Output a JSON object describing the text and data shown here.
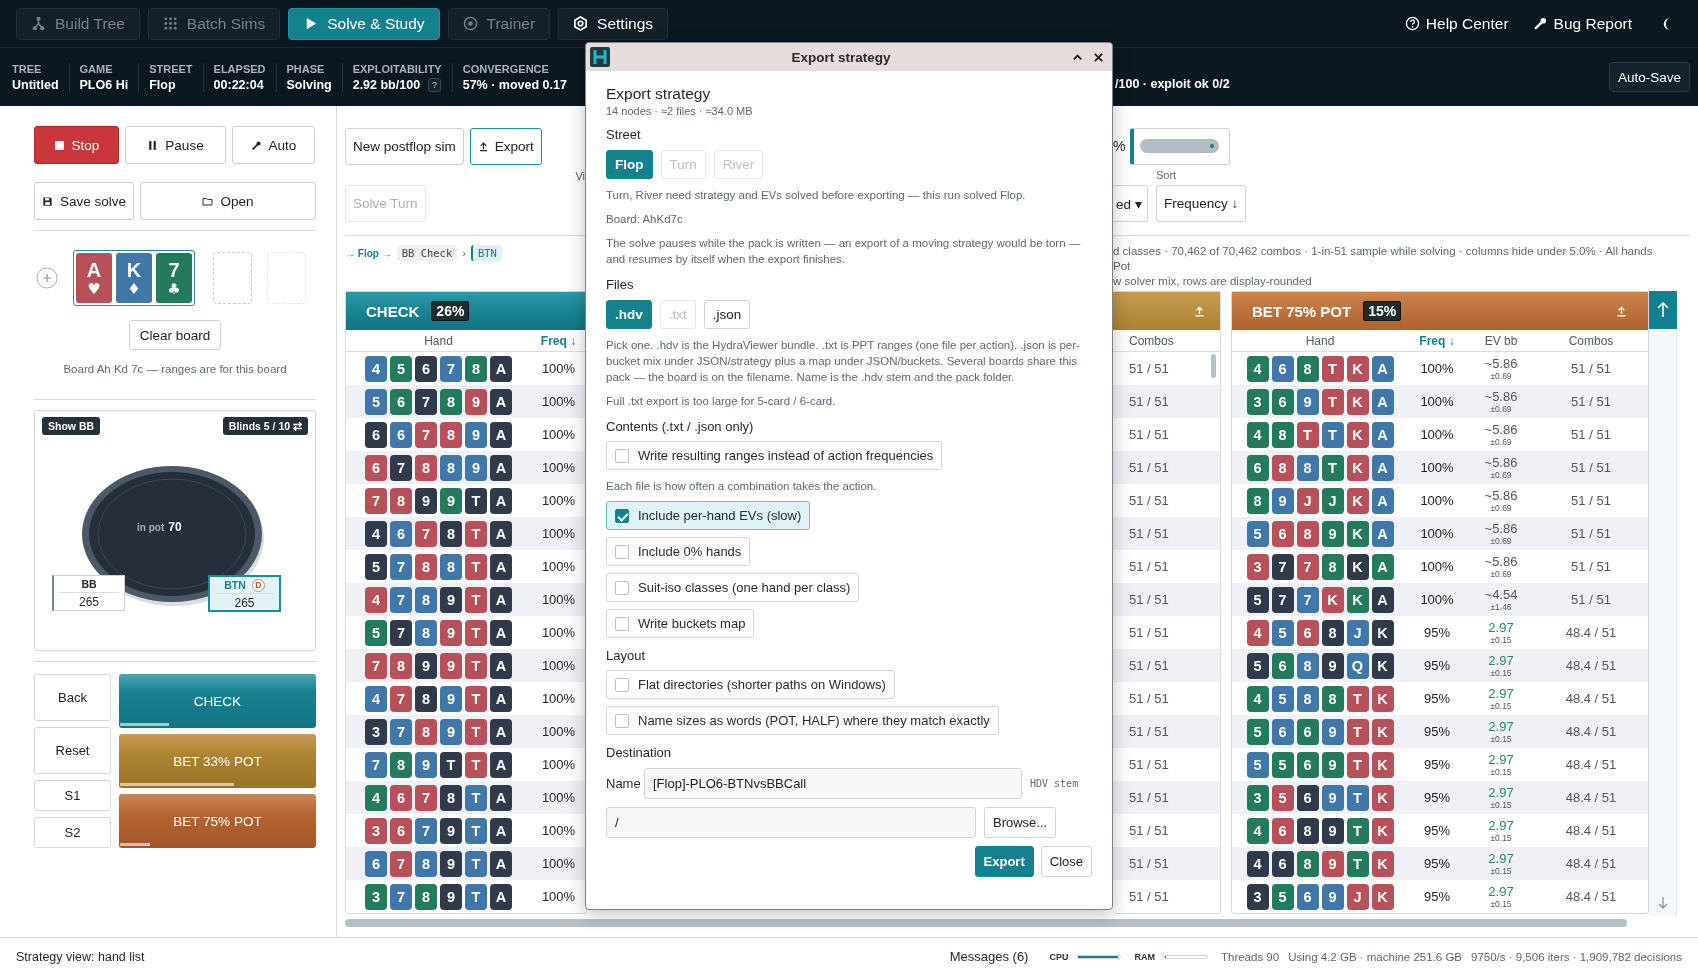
{
  "nav": {
    "tabs": [
      {
        "label": "Build Tree",
        "selected": false,
        "disabled": true
      },
      {
        "label": "Batch Sims",
        "selected": false,
        "disabled": true
      },
      {
        "label": "Solve & Study",
        "selected": true,
        "disabled": false
      },
      {
        "label": "Trainer",
        "selected": false,
        "disabled": true
      },
      {
        "label": "Settings",
        "selected": false,
        "disabled": false
      }
    ],
    "links": [
      "Help Center",
      "Bug Report"
    ]
  },
  "stats": {
    "items": [
      {
        "label": "TREE",
        "value": "Untitled"
      },
      {
        "label": "GAME",
        "value": "PLO6 Hi"
      },
      {
        "label": "STREET",
        "value": "Flop"
      },
      {
        "label": "ELAPSED",
        "value": "00:22:04"
      },
      {
        "label": "PHASE",
        "value": "Solving"
      },
      {
        "label": "EXPLOITABILITY",
        "value": "2.92 bb/100",
        "help": "?"
      },
      {
        "label": "CONVERGENCE",
        "value": "57% · moved 0.17"
      }
    ],
    "tail": "/100 · exploit ok 0/2",
    "auto_save": "Auto-Save"
  },
  "sidebar": {
    "run_buttons": [
      {
        "label": "Stop",
        "kind": "stop"
      },
      {
        "label": "Pause",
        "kind": "pause"
      },
      {
        "label": "Auto",
        "kind": "auto"
      }
    ],
    "file_buttons": [
      {
        "label": "Save solve",
        "kind": "save"
      },
      {
        "label": "Open",
        "kind": "open"
      }
    ],
    "board": {
      "cards": [
        {
          "rank": "A",
          "suit": "♥",
          "color": "#b8505a"
        },
        {
          "rank": "K",
          "suit": "♦",
          "color": "#3f78a8"
        },
        {
          "rank": "7",
          "suit": "♣",
          "color": "#237a5c"
        }
      ],
      "clear": "Clear board",
      "caption": "Board Ah Kd 7c — ranges are for this board"
    },
    "table": {
      "show_bb": "Show BB",
      "blinds": "Blinds 5 / 10 ⇄",
      "pot_label": "in pot",
      "pot": "70",
      "seats": [
        {
          "name": "BB",
          "stack": "265",
          "active": false
        },
        {
          "name": "BTN",
          "stack": "265",
          "active": true,
          "dealer": "D"
        }
      ]
    },
    "nav_buttons": [
      "Back",
      "Reset",
      "S1",
      "S2"
    ],
    "actions": [
      {
        "label": "CHECK",
        "kind": "check",
        "level": 0.25
      },
      {
        "label": "BET 33% POT",
        "kind": "bet_small",
        "level": 0.58
      },
      {
        "label": "BET 75% POT",
        "kind": "bet_large",
        "level": 0.15
      }
    ]
  },
  "toolbar": {
    "buttons": [
      {
        "label": "New postflop sim",
        "kind": "plain",
        "focused": false
      },
      {
        "label": "Export",
        "kind": "export",
        "focused": true
      }
    ],
    "solve_turn": {
      "label": "Solve Turn",
      "disabled": true
    },
    "view_label": "Vi",
    "percent": "%",
    "slider": {
      "level": 0.95
    },
    "filter": "ed ▾",
    "sort_label": "Sort",
    "sort": "Frequency ↓"
  },
  "breadcrumb": {
    "lead": "→ Flop →",
    "sep": "›",
    "steps": [
      {
        "label": "BB Check",
        "selected": false
      },
      {
        "label": "BTN",
        "selected": true
      }
    ]
  },
  "info_lines": [
    "d classes · 70,462 of 70,462 combos · 1-in-51 sample while solving · columns hide under 5.0% · All hands",
    "Pot",
    "w solver mix, rows are display-rounded"
  ],
  "panels": {
    "check": {
      "title": "CHECK",
      "share": "26%",
      "columns": [
        {
          "label": "Hand",
          "sorted": false
        },
        {
          "label": "Freq ↓",
          "sorted": true
        }
      ],
      "rows": [
        {
          "cards": [
            {
              "rank": "4",
              "color": "#3f78a8"
            },
            {
              "rank": "5",
              "color": "#237a5c"
            },
            {
              "rank": "6",
              "color": "#303a4b"
            },
            {
              "rank": "7",
              "color": "#3f78a8"
            },
            {
              "rank": "8",
              "color": "#237a5c"
            },
            {
              "rank": "A",
              "color": "#303a4b"
            }
          ],
          "freq": "100%"
        },
        {
          "cards": [
            {
              "rank": "5",
              "color": "#3f78a8"
            },
            {
              "rank": "6",
              "color": "#237a5c"
            },
            {
              "rank": "7",
              "color": "#303a4b"
            },
            {
              "rank": "8",
              "color": "#237a5c"
            },
            {
              "rank": "9",
              "color": "#b8505a"
            },
            {
              "rank": "A",
              "color": "#303a4b"
            }
          ],
          "freq": "100%"
        },
        {
          "cards": [
            {
              "rank": "6",
              "color": "#303a4b"
            },
            {
              "rank": "6",
              "color": "#3f78a8"
            },
            {
              "rank": "7",
              "color": "#b8505a"
            },
            {
              "rank": "8",
              "color": "#b8505a"
            },
            {
              "rank": "9",
              "color": "#3f78a8"
            },
            {
              "rank": "A",
              "color": "#303a4b"
            }
          ],
          "freq": "100%"
        },
        {
          "cards": [
            {
              "rank": "6",
              "color": "#b8505a"
            },
            {
              "rank": "7",
              "color": "#303a4b"
            },
            {
              "rank": "8",
              "color": "#b8505a"
            },
            {
              "rank": "8",
              "color": "#3f78a8"
            },
            {
              "rank": "9",
              "color": "#3f78a8"
            },
            {
              "rank": "A",
              "color": "#303a4b"
            }
          ],
          "freq": "100%"
        },
        {
          "cards": [
            {
              "rank": "7",
              "color": "#b8505a"
            },
            {
              "rank": "8",
              "color": "#b8505a"
            },
            {
              "rank": "9",
              "color": "#303a4b"
            },
            {
              "rank": "9",
              "color": "#237a5c"
            },
            {
              "rank": "T",
              "color": "#303a4b"
            },
            {
              "rank": "A",
              "color": "#303a4b"
            }
          ],
          "freq": "100%"
        },
        {
          "cards": [
            {
              "rank": "4",
              "color": "#303a4b"
            },
            {
              "rank": "6",
              "color": "#3f78a8"
            },
            {
              "rank": "7",
              "color": "#b8505a"
            },
            {
              "rank": "8",
              "color": "#303a4b"
            },
            {
              "rank": "T",
              "color": "#b8505a"
            },
            {
              "rank": "A",
              "color": "#303a4b"
            }
          ],
          "freq": "100%"
        },
        {
          "cards": [
            {
              "rank": "5",
              "color": "#303a4b"
            },
            {
              "rank": "7",
              "color": "#3f78a8"
            },
            {
              "rank": "8",
              "color": "#b8505a"
            },
            {
              "rank": "8",
              "color": "#3f78a8"
            },
            {
              "rank": "T",
              "color": "#b8505a"
            },
            {
              "rank": "A",
              "color": "#303a4b"
            }
          ],
          "freq": "100%"
        },
        {
          "cards": [
            {
              "rank": "4",
              "color": "#b8505a"
            },
            {
              "rank": "7",
              "color": "#3f78a8"
            },
            {
              "rank": "8",
              "color": "#3f78a8"
            },
            {
              "rank": "9",
              "color": "#303a4b"
            },
            {
              "rank": "T",
              "color": "#b8505a"
            },
            {
              "rank": "A",
              "color": "#303a4b"
            }
          ],
          "freq": "100%"
        },
        {
          "cards": [
            {
              "rank": "5",
              "color": "#237a5c"
            },
            {
              "rank": "7",
              "color": "#303a4b"
            },
            {
              "rank": "8",
              "color": "#3f78a8"
            },
            {
              "rank": "9",
              "color": "#b8505a"
            },
            {
              "rank": "T",
              "color": "#b8505a"
            },
            {
              "rank": "A",
              "color": "#303a4b"
            }
          ],
          "freq": "100%"
        },
        {
          "cards": [
            {
              "rank": "7",
              "color": "#b8505a"
            },
            {
              "rank": "8",
              "color": "#b8505a"
            },
            {
              "rank": "9",
              "color": "#303a4b"
            },
            {
              "rank": "9",
              "color": "#b8505a"
            },
            {
              "rank": "T",
              "color": "#b8505a"
            },
            {
              "rank": "A",
              "color": "#303a4b"
            }
          ],
          "freq": "100%"
        },
        {
          "cards": [
            {
              "rank": "4",
              "color": "#3f78a8"
            },
            {
              "rank": "7",
              "color": "#b8505a"
            },
            {
              "rank": "8",
              "color": "#303a4b"
            },
            {
              "rank": "9",
              "color": "#3f78a8"
            },
            {
              "rank": "T",
              "color": "#b8505a"
            },
            {
              "rank": "A",
              "color": "#303a4b"
            }
          ],
          "freq": "100%"
        },
        {
          "cards": [
            {
              "rank": "3",
              "color": "#303a4b"
            },
            {
              "rank": "7",
              "color": "#3f78a8"
            },
            {
              "rank": "8",
              "color": "#b8505a"
            },
            {
              "rank": "9",
              "color": "#3f78a8"
            },
            {
              "rank": "T",
              "color": "#b8505a"
            },
            {
              "rank": "A",
              "color": "#303a4b"
            }
          ],
          "freq": "100%"
        },
        {
          "cards": [
            {
              "rank": "7",
              "color": "#3f78a8"
            },
            {
              "rank": "8",
              "color": "#237a5c"
            },
            {
              "rank": "9",
              "color": "#3f78a8"
            },
            {
              "rank": "T",
              "color": "#303a4b"
            },
            {
              "rank": "T",
              "color": "#b8505a"
            },
            {
              "rank": "A",
              "color": "#303a4b"
            }
          ],
          "freq": "100%"
        },
        {
          "cards": [
            {
              "rank": "4",
              "color": "#237a5c"
            },
            {
              "rank": "6",
              "color": "#b8505a"
            },
            {
              "rank": "7",
              "color": "#b8505a"
            },
            {
              "rank": "8",
              "color": "#303a4b"
            },
            {
              "rank": "T",
              "color": "#3f78a8"
            },
            {
              "rank": "A",
              "color": "#303a4b"
            }
          ],
          "freq": "100%"
        },
        {
          "cards": [
            {
              "rank": "3",
              "color": "#b8505a"
            },
            {
              "rank": "6",
              "color": "#b8505a"
            },
            {
              "rank": "7",
              "color": "#3f78a8"
            },
            {
              "rank": "9",
              "color": "#303a4b"
            },
            {
              "rank": "T",
              "color": "#3f78a8"
            },
            {
              "rank": "A",
              "color": "#303a4b"
            }
          ],
          "freq": "100%"
        },
        {
          "cards": [
            {
              "rank": "6",
              "color": "#3f78a8"
            },
            {
              "rank": "7",
              "color": "#b8505a"
            },
            {
              "rank": "8",
              "color": "#3f78a8"
            },
            {
              "rank": "9",
              "color": "#303a4b"
            },
            {
              "rank": "T",
              "color": "#3f78a8"
            },
            {
              "rank": "A",
              "color": "#303a4b"
            }
          ],
          "freq": "100%"
        },
        {
          "cards": [
            {
              "rank": "3",
              "color": "#237a5c"
            },
            {
              "rank": "7",
              "color": "#3f78a8"
            },
            {
              "rank": "8",
              "color": "#237a5c"
            },
            {
              "rank": "9",
              "color": "#303a4b"
            },
            {
              "rank": "T",
              "color": "#3f78a8"
            },
            {
              "rank": "A",
              "color": "#303a4b"
            }
          ],
          "freq": "100%"
        }
      ]
    },
    "bet33": {
      "columns": [
        "Combos"
      ],
      "rows": [
        "51 / 51",
        "51 / 51",
        "51 / 51",
        "51 / 51",
        "51 / 51",
        "51 / 51",
        "51 / 51",
        "51 / 51",
        "51 / 51",
        "51 / 51",
        "51 / 51",
        "51 / 51",
        "51 / 51",
        "51 / 51",
        "51 / 51",
        "51 / 51",
        "51 / 51"
      ]
    },
    "bet75": {
      "title": "BET 75% POT",
      "share": "15%",
      "columns": [
        {
          "label": "Hand",
          "sorted": false
        },
        {
          "label": "Freq ↓",
          "sorted": true
        },
        {
          "label": "EV bb",
          "sorted": false
        },
        {
          "label": "Combos",
          "sorted": false
        }
      ],
      "rows": [
        {
          "cards": [
            {
              "rank": "4",
              "color": "#237a5c"
            },
            {
              "rank": "6",
              "color": "#3f78a8"
            },
            {
              "rank": "8",
              "color": "#237a5c"
            },
            {
              "rank": "T",
              "color": "#b8505a"
            },
            {
              "rank": "K",
              "color": "#b8505a"
            },
            {
              "rank": "A",
              "color": "#3f78a8"
            }
          ],
          "freq": "100%",
          "ev": "~5.86",
          "ev_err": "±0.69",
          "ev_estimated": true,
          "combos": "51 / 51"
        },
        {
          "cards": [
            {
              "rank": "3",
              "color": "#237a5c"
            },
            {
              "rank": "6",
              "color": "#237a5c"
            },
            {
              "rank": "9",
              "color": "#3f78a8"
            },
            {
              "rank": "T",
              "color": "#b8505a"
            },
            {
              "rank": "K",
              "color": "#b8505a"
            },
            {
              "rank": "A",
              "color": "#3f78a8"
            }
          ],
          "freq": "100%",
          "ev": "~5.86",
          "ev_err": "±0.69",
          "ev_estimated": true,
          "combos": "51 / 51"
        },
        {
          "cards": [
            {
              "rank": "4",
              "color": "#237a5c"
            },
            {
              "rank": "8",
              "color": "#237a5c"
            },
            {
              "rank": "T",
              "color": "#b8505a"
            },
            {
              "rank": "T",
              "color": "#3f78a8"
            },
            {
              "rank": "K",
              "color": "#b8505a"
            },
            {
              "rank": "A",
              "color": "#3f78a8"
            }
          ],
          "freq": "100%",
          "ev": "~5.86",
          "ev_err": "±0.69",
          "ev_estimated": true,
          "combos": "51 / 51"
        },
        {
          "cards": [
            {
              "rank": "6",
              "color": "#237a5c"
            },
            {
              "rank": "8",
              "color": "#b8505a"
            },
            {
              "rank": "8",
              "color": "#3f78a8"
            },
            {
              "rank": "T",
              "color": "#237a5c"
            },
            {
              "rank": "K",
              "color": "#b8505a"
            },
            {
              "rank": "A",
              "color": "#3f78a8"
            }
          ],
          "freq": "100%",
          "ev": "~5.86",
          "ev_err": "±0.69",
          "ev_estimated": true,
          "combos": "51 / 51"
        },
        {
          "cards": [
            {
              "rank": "8",
              "color": "#237a5c"
            },
            {
              "rank": "9",
              "color": "#3f78a8"
            },
            {
              "rank": "J",
              "color": "#b8505a"
            },
            {
              "rank": "J",
              "color": "#237a5c"
            },
            {
              "rank": "K",
              "color": "#b8505a"
            },
            {
              "rank": "A",
              "color": "#3f78a8"
            }
          ],
          "freq": "100%",
          "ev": "~5.86",
          "ev_err": "±0.69",
          "ev_estimated": true,
          "combos": "51 / 51"
        },
        {
          "cards": [
            {
              "rank": "5",
              "color": "#3f78a8"
            },
            {
              "rank": "6",
              "color": "#b8505a"
            },
            {
              "rank": "8",
              "color": "#b8505a"
            },
            {
              "rank": "9",
              "color": "#237a5c"
            },
            {
              "rank": "K",
              "color": "#237a5c"
            },
            {
              "rank": "A",
              "color": "#3f78a8"
            }
          ],
          "freq": "100%",
          "ev": "~5.86",
          "ev_err": "±0.69",
          "ev_estimated": true,
          "combos": "51 / 51"
        },
        {
          "cards": [
            {
              "rank": "3",
              "color": "#b8505a"
            },
            {
              "rank": "7",
              "color": "#303a4b"
            },
            {
              "rank": "7",
              "color": "#b8505a"
            },
            {
              "rank": "8",
              "color": "#237a5c"
            },
            {
              "rank": "K",
              "color": "#303a4b"
            },
            {
              "rank": "A",
              "color": "#237a5c"
            }
          ],
          "freq": "100%",
          "ev": "~5.86",
          "ev_err": "±0.69",
          "ev_estimated": true,
          "combos": "51 / 51"
        },
        {
          "cards": [
            {
              "rank": "5",
              "color": "#303a4b"
            },
            {
              "rank": "7",
              "color": "#303a4b"
            },
            {
              "rank": "7",
              "color": "#3f78a8"
            },
            {
              "rank": "K",
              "color": "#b8505a"
            },
            {
              "rank": "K",
              "color": "#237a5c"
            },
            {
              "rank": "A",
              "color": "#303a4b"
            }
          ],
          "freq": "100%",
          "ev": "~4.54",
          "ev_err": "±1.46",
          "ev_estimated": true,
          "combos": "51 / 51"
        },
        {
          "cards": [
            {
              "rank": "4",
              "color": "#b8505a"
            },
            {
              "rank": "5",
              "color": "#3f78a8"
            },
            {
              "rank": "6",
              "color": "#b8505a"
            },
            {
              "rank": "8",
              "color": "#303a4b"
            },
            {
              "rank": "J",
              "color": "#3f78a8"
            },
            {
              "rank": "K",
              "color": "#303a4b"
            }
          ],
          "freq": "95%",
          "ev": "2.97",
          "ev_err": "±0.15",
          "ev_estimated": false,
          "combos": "48.4 / 51"
        },
        {
          "cards": [
            {
              "rank": "5",
              "color": "#303a4b"
            },
            {
              "rank": "6",
              "color": "#237a5c"
            },
            {
              "rank": "8",
              "color": "#3f78a8"
            },
            {
              "rank": "9",
              "color": "#303a4b"
            },
            {
              "rank": "Q",
              "color": "#3f78a8"
            },
            {
              "rank": "K",
              "color": "#303a4b"
            }
          ],
          "freq": "95%",
          "ev": "2.97",
          "ev_err": "±0.15",
          "ev_estimated": false,
          "combos": "48.4 / 51"
        },
        {
          "cards": [
            {
              "rank": "4",
              "color": "#237a5c"
            },
            {
              "rank": "5",
              "color": "#3f78a8"
            },
            {
              "rank": "8",
              "color": "#3f78a8"
            },
            {
              "rank": "8",
              "color": "#237a5c"
            },
            {
              "rank": "T",
              "color": "#b8505a"
            },
            {
              "rank": "K",
              "color": "#b8505a"
            }
          ],
          "freq": "95%",
          "ev": "2.97",
          "ev_err": "±0.15",
          "ev_estimated": false,
          "combos": "48.4 / 51"
        },
        {
          "cards": [
            {
              "rank": "5",
              "color": "#237a5c"
            },
            {
              "rank": "6",
              "color": "#3f78a8"
            },
            {
              "rank": "6",
              "color": "#237a5c"
            },
            {
              "rank": "9",
              "color": "#3f78a8"
            },
            {
              "rank": "T",
              "color": "#b8505a"
            },
            {
              "rank": "K",
              "color": "#b8505a"
            }
          ],
          "freq": "95%",
          "ev": "2.97",
          "ev_err": "±0.15",
          "ev_estimated": false,
          "combos": "48.4 / 51"
        },
        {
          "cards": [
            {
              "rank": "5",
              "color": "#3f78a8"
            },
            {
              "rank": "5",
              "color": "#237a5c"
            },
            {
              "rank": "6",
              "color": "#237a5c"
            },
            {
              "rank": "9",
              "color": "#237a5c"
            },
            {
              "rank": "T",
              "color": "#b8505a"
            },
            {
              "rank": "K",
              "color": "#b8505a"
            }
          ],
          "freq": "95%",
          "ev": "2.97",
          "ev_err": "±0.15",
          "ev_estimated": false,
          "combos": "48.4 / 51"
        },
        {
          "cards": [
            {
              "rank": "3",
              "color": "#237a5c"
            },
            {
              "rank": "5",
              "color": "#b8505a"
            },
            {
              "rank": "6",
              "color": "#303a4b"
            },
            {
              "rank": "9",
              "color": "#3f78a8"
            },
            {
              "rank": "T",
              "color": "#3f78a8"
            },
            {
              "rank": "K",
              "color": "#b8505a"
            }
          ],
          "freq": "95%",
          "ev": "2.97",
          "ev_err": "±0.15",
          "ev_estimated": false,
          "combos": "48.4 / 51"
        },
        {
          "cards": [
            {
              "rank": "4",
              "color": "#237a5c"
            },
            {
              "rank": "6",
              "color": "#b8505a"
            },
            {
              "rank": "8",
              "color": "#303a4b"
            },
            {
              "rank": "9",
              "color": "#303a4b"
            },
            {
              "rank": "T",
              "color": "#237a5c"
            },
            {
              "rank": "K",
              "color": "#b8505a"
            }
          ],
          "freq": "95%",
          "ev": "2.97",
          "ev_err": "±0.15",
          "ev_estimated": false,
          "combos": "48.4 / 51"
        },
        {
          "cards": [
            {
              "rank": "4",
              "color": "#303a4b"
            },
            {
              "rank": "6",
              "color": "#303a4b"
            },
            {
              "rank": "8",
              "color": "#237a5c"
            },
            {
              "rank": "9",
              "color": "#b8505a"
            },
            {
              "rank": "T",
              "color": "#237a5c"
            },
            {
              "rank": "K",
              "color": "#b8505a"
            }
          ],
          "freq": "95%",
          "ev": "2.97",
          "ev_err": "±0.15",
          "ev_estimated": false,
          "combos": "48.4 / 51"
        },
        {
          "cards": [
            {
              "rank": "3",
              "color": "#303a4b"
            },
            {
              "rank": "5",
              "color": "#237a5c"
            },
            {
              "rank": "6",
              "color": "#3f78a8"
            },
            {
              "rank": "9",
              "color": "#3f78a8"
            },
            {
              "rank": "J",
              "color": "#b8505a"
            },
            {
              "rank": "K",
              "color": "#b8505a"
            }
          ],
          "freq": "95%",
          "ev": "2.97",
          "ev_err": "±0.15",
          "ev_estimated": false,
          "combos": "48.4 / 51"
        }
      ]
    }
  },
  "dialog": {
    "title": "Export strategy",
    "heading": "Export strategy",
    "summary": "14 nodes · ≈2 files · ≈34.0 MB",
    "street": {
      "label": "Street",
      "options": [
        {
          "label": "Flop",
          "selected": true,
          "disabled": false
        },
        {
          "label": "Turn",
          "selected": false,
          "disabled": true
        },
        {
          "label": "River",
          "selected": false,
          "disabled": true
        }
      ]
    },
    "street_note": "Turn, River need strategy and EVs solved before exporting — this run solved Flop.",
    "board": "Board: AhKd7c",
    "pause_note": "The solve pauses while the pack is written — an export of a moving strategy would be torn — and resumes by itself when the export finishes.",
    "files": {
      "label": "Files",
      "options": [
        {
          "label": ".hdv",
          "selected": true,
          "disabled": false
        },
        {
          "label": ".txt",
          "selected": false,
          "disabled": true
        },
        {
          "label": ".json",
          "selected": false,
          "disabled": false
        }
      ]
    },
    "files_note": "Pick one. .hdv is the HydraViewer bundle. .txt is PPT ranges (one file per action). .json is per-bucket mix under JSON/strategy plus a map under JSON/buckets. Several boards share this pack — the board is on the filename. Name is the .hdv stem and the pack folder.",
    "txt_note": "Full .txt export is too large for 5-card / 6-card.",
    "contents": {
      "label": "Contents (.txt / .json only)",
      "options": [
        {
          "label": "Write resulting ranges instead of action frequencies",
          "checked": false,
          "note": "Each file is how often a combination takes the action."
        },
        {
          "label": "Include per-hand EVs (slow)",
          "checked": true
        },
        {
          "label": "Include 0% hands",
          "checked": false
        },
        {
          "label": "Suit-iso classes (one hand per class)",
          "checked": false
        },
        {
          "label": "Write buckets map",
          "checked": false
        }
      ]
    },
    "layout": {
      "label": "Layout",
      "options": [
        {
          "label": "Flat directories (shorter paths on Windows)",
          "checked": false
        },
        {
          "label": "Name sizes as words (POT, HALF) where they match exactly",
          "checked": false
        }
      ]
    },
    "destination": {
      "label": "Destination",
      "name_label": "Name",
      "name_value": "[Flop]-PLO6-BTNvsBBCall",
      "name_hint": "HDV stem",
      "path_value": "/",
      "browse": "Browse..."
    },
    "buttons": [
      {
        "label": "Export",
        "kind": "primary"
      },
      {
        "label": "Close",
        "kind": "plain"
      }
    ]
  },
  "footer": {
    "status": "Strategy view: hand list",
    "messages": "Messages (6)",
    "cpu": {
      "label": "CPU",
      "level": 0.95
    },
    "ram": {
      "label": "RAM",
      "level": 0.03
    },
    "threads": "Threads 90",
    "memory": "Using 4.2 GB · machine 251.6 GB",
    "rate": "9750/s · 9,506 iters · 1,909,782 decisions"
  }
}
